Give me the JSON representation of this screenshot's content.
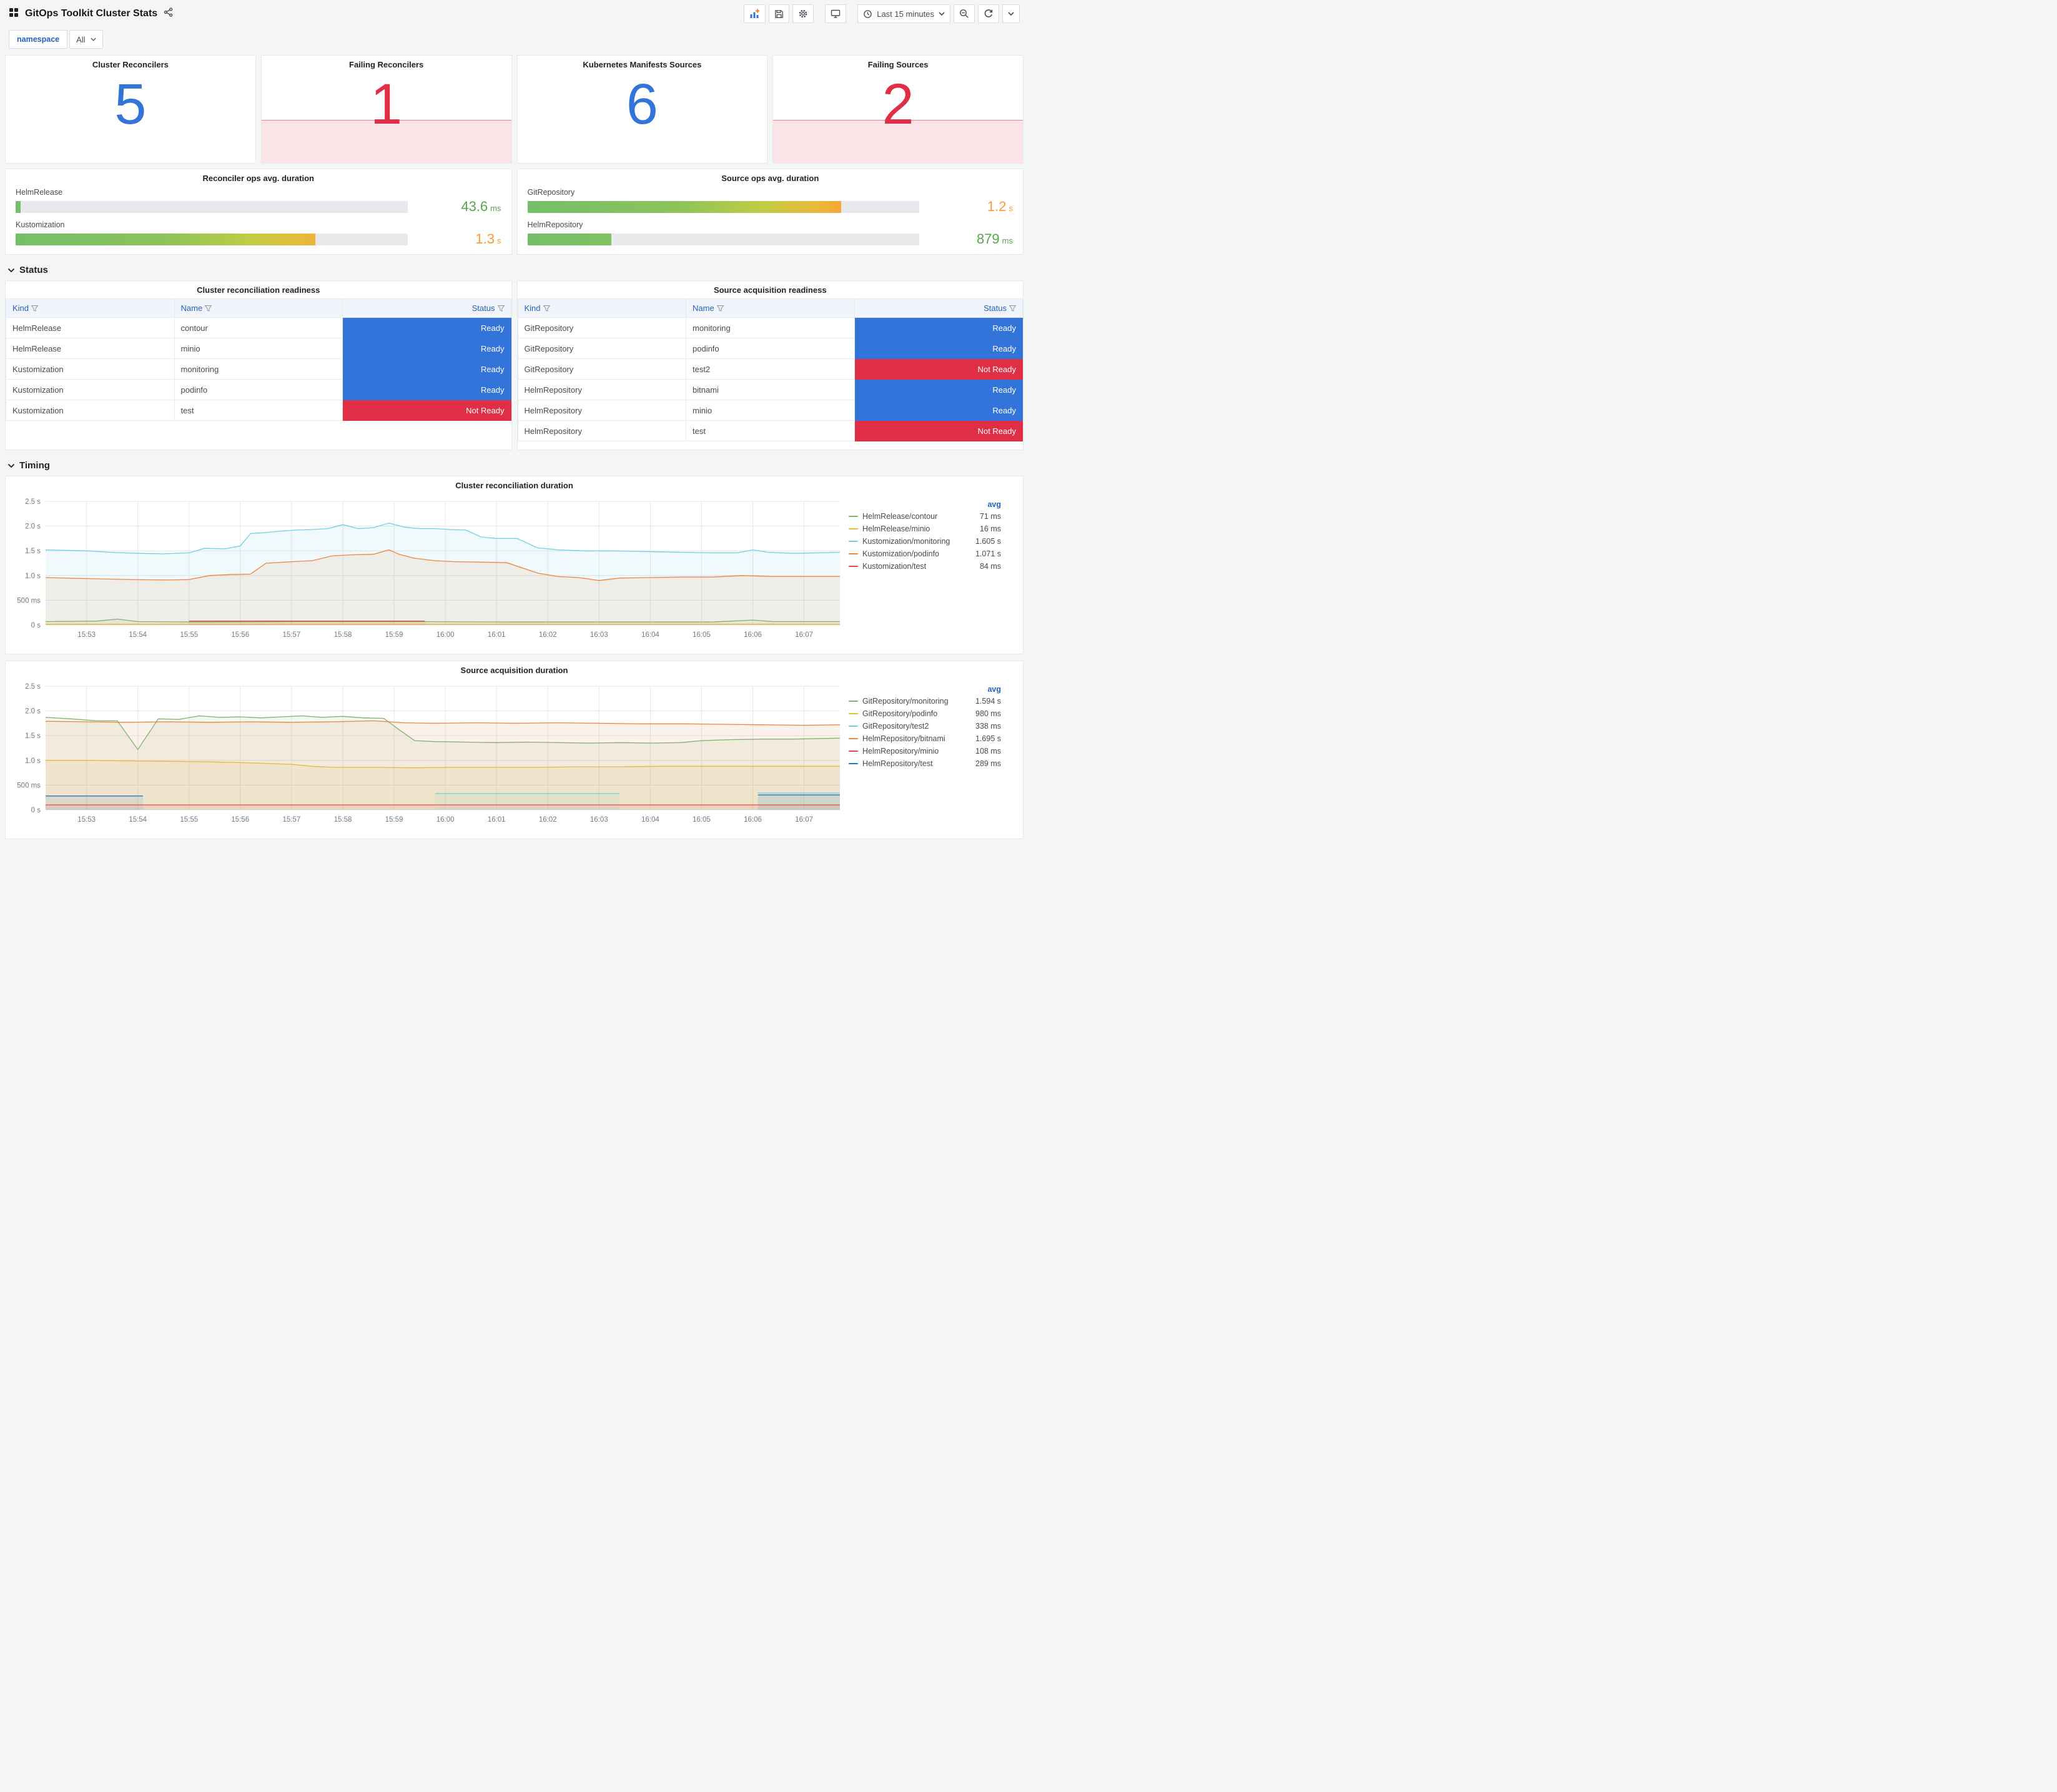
{
  "header": {
    "title": "GitOps Toolkit Cluster Stats",
    "time_range_label": "Last 15 minutes"
  },
  "variables": {
    "label": "namespace",
    "value": "All"
  },
  "icons": [
    "apps-icon",
    "share-icon",
    "add-panel-icon",
    "save-icon",
    "gear-icon",
    "tv-icon",
    "clock-icon",
    "caret-down-icon",
    "zoom-out-icon",
    "refresh-icon",
    "filter-icon",
    "chevron-down-icon"
  ],
  "sections": {
    "status": "Status",
    "timing": "Timing"
  },
  "stats": [
    {
      "title": "Cluster Reconcilers",
      "value": "5",
      "color": "#3274d9",
      "alert_band": false
    },
    {
      "title": "Failing Reconcilers",
      "value": "1",
      "color": "#e02f44",
      "alert_band": true
    },
    {
      "title": "Kubernetes Manifests Sources",
      "value": "6",
      "color": "#3274d9",
      "alert_band": false
    },
    {
      "title": "Failing Sources",
      "value": "2",
      "color": "#e02f44",
      "alert_band": true
    }
  ],
  "gauges": [
    {
      "title": "Reconciler ops avg. duration",
      "bars": [
        {
          "label": "HelmRelease",
          "value": "43.6",
          "unit": "ms",
          "percent": 1.2,
          "value_color": "#56a64b"
        },
        {
          "label": "Kustomization",
          "value": "1.3",
          "unit": "s",
          "percent": 76.5,
          "value_color": "#ff9830"
        }
      ]
    },
    {
      "title": "Source ops avg. duration",
      "bars": [
        {
          "label": "GitRepository",
          "value": "1.2",
          "unit": "s",
          "percent": 80,
          "value_color": "#ff9830"
        },
        {
          "label": "HelmRepository",
          "value": "879",
          "unit": "ms",
          "percent": 21.5,
          "value_color": "#56a64b"
        }
      ]
    }
  ],
  "tables": [
    {
      "title": "Cluster reconciliation readiness",
      "columns": [
        "Kind",
        "Name",
        "Status"
      ],
      "rows": [
        {
          "kind": "HelmRelease",
          "name": "contour",
          "status": "Ready"
        },
        {
          "kind": "HelmRelease",
          "name": "minio",
          "status": "Ready"
        },
        {
          "kind": "Kustomization",
          "name": "monitoring",
          "status": "Ready"
        },
        {
          "kind": "Kustomization",
          "name": "podinfo",
          "status": "Ready"
        },
        {
          "kind": "Kustomization",
          "name": "test",
          "status": "Not Ready"
        }
      ]
    },
    {
      "title": "Source acquisition readiness",
      "columns": [
        "Kind",
        "Name",
        "Status"
      ],
      "rows": [
        {
          "kind": "GitRepository",
          "name": "monitoring",
          "status": "Ready"
        },
        {
          "kind": "GitRepository",
          "name": "podinfo",
          "status": "Ready"
        },
        {
          "kind": "GitRepository",
          "name": "test2",
          "status": "Not Ready"
        },
        {
          "kind": "HelmRepository",
          "name": "bitnami",
          "status": "Ready"
        },
        {
          "kind": "HelmRepository",
          "name": "minio",
          "status": "Ready"
        },
        {
          "kind": "HelmRepository",
          "name": "test",
          "status": "Not Ready"
        }
      ]
    }
  ],
  "chart_data": [
    {
      "type": "line",
      "title": "Cluster reconciliation duration",
      "legend_header": "avg",
      "x_domain": [
        0,
        15.5
      ],
      "y_domain": [
        0,
        2.5
      ],
      "x_tick_start": 0.8,
      "x_tick_step": 1,
      "x_tick_labels": [
        "15:53",
        "15:54",
        "15:55",
        "15:56",
        "15:57",
        "15:58",
        "15:59",
        "16:00",
        "16:01",
        "16:02",
        "16:03",
        "16:04",
        "16:05",
        "16:06",
        "16:07"
      ],
      "y_ticks": [
        {
          "v": 0,
          "label": "0 s"
        },
        {
          "v": 0.5,
          "label": "500 ms"
        },
        {
          "v": 1,
          "label": "1.0 s"
        },
        {
          "v": 1.5,
          "label": "1.5 s"
        },
        {
          "v": 2,
          "label": "2.0 s"
        },
        {
          "v": 2.5,
          "label": "2.5 s"
        }
      ],
      "series": [
        {
          "name": "HelmRelease/contour",
          "color": "#7EB26D",
          "avg": "71 ms",
          "points": [
            [
              0,
              0.07
            ],
            [
              1,
              0.08
            ],
            [
              1.4,
              0.12
            ],
            [
              1.8,
              0.07
            ],
            [
              3,
              0.06
            ],
            [
              5,
              0.07
            ],
            [
              7,
              0.07
            ],
            [
              9,
              0.06
            ],
            [
              11,
              0.06
            ],
            [
              13,
              0.06
            ],
            [
              13.8,
              0.1
            ],
            [
              14.2,
              0.07
            ],
            [
              15.5,
              0.07
            ]
          ]
        },
        {
          "name": "HelmRelease/minio",
          "color": "#EAB839",
          "avg": "16 ms",
          "points": [
            [
              0,
              0.016
            ],
            [
              15.5,
              0.016
            ]
          ]
        },
        {
          "name": "Kustomization/monitoring",
          "color": "#6ED0E0",
          "avg": "1.605 s",
          "points": [
            [
              0,
              1.52
            ],
            [
              0.8,
              1.5
            ],
            [
              1.3,
              1.47
            ],
            [
              1.8,
              1.45
            ],
            [
              2.3,
              1.44
            ],
            [
              2.8,
              1.46
            ],
            [
              3.1,
              1.55
            ],
            [
              3.5,
              1.54
            ],
            [
              3.8,
              1.6
            ],
            [
              4,
              1.85
            ],
            [
              4.3,
              1.87
            ],
            [
              4.6,
              1.9
            ],
            [
              4.9,
              1.92
            ],
            [
              5.2,
              1.93
            ],
            [
              5.5,
              1.95
            ],
            [
              5.8,
              2.03
            ],
            [
              6.1,
              1.95
            ],
            [
              6.4,
              1.97
            ],
            [
              6.7,
              2.06
            ],
            [
              7,
              1.98
            ],
            [
              7.3,
              1.95
            ],
            [
              7.6,
              1.95
            ],
            [
              7.9,
              1.93
            ],
            [
              8.2,
              1.92
            ],
            [
              8.5,
              1.78
            ],
            [
              8.8,
              1.75
            ],
            [
              9.2,
              1.75
            ],
            [
              9.6,
              1.56
            ],
            [
              10,
              1.52
            ],
            [
              10.5,
              1.5
            ],
            [
              11,
              1.5
            ],
            [
              11.5,
              1.49
            ],
            [
              12,
              1.48
            ],
            [
              12.5,
              1.47
            ],
            [
              13,
              1.46
            ],
            [
              13.5,
              1.46
            ],
            [
              13.8,
              1.52
            ],
            [
              14.1,
              1.47
            ],
            [
              14.6,
              1.45
            ],
            [
              15.5,
              1.47
            ]
          ]
        },
        {
          "name": "Kustomization/podinfo",
          "color": "#EF843C",
          "avg": "1.071 s",
          "points": [
            [
              0,
              0.96
            ],
            [
              0.8,
              0.94
            ],
            [
              1.6,
              0.92
            ],
            [
              2.4,
              0.91
            ],
            [
              2.8,
              0.92
            ],
            [
              3.2,
              1
            ],
            [
              3.6,
              1.02
            ],
            [
              4,
              1.03
            ],
            [
              4.3,
              1.25
            ],
            [
              4.8,
              1.28
            ],
            [
              5.2,
              1.3
            ],
            [
              5.6,
              1.4
            ],
            [
              6,
              1.42
            ],
            [
              6.4,
              1.43
            ],
            [
              6.7,
              1.52
            ],
            [
              6.9,
              1.43
            ],
            [
              7.2,
              1.35
            ],
            [
              7.6,
              1.3
            ],
            [
              8,
              1.28
            ],
            [
              8.6,
              1.27
            ],
            [
              9,
              1.26
            ],
            [
              9.6,
              1.05
            ],
            [
              10,
              0.98
            ],
            [
              10.4,
              0.96
            ],
            [
              10.8,
              0.9
            ],
            [
              11.2,
              0.95
            ],
            [
              11.8,
              0.96
            ],
            [
              12.4,
              0.97
            ],
            [
              13,
              0.97
            ],
            [
              13.6,
              1
            ],
            [
              14.2,
              0.98
            ],
            [
              15.5,
              0.98
            ]
          ]
        },
        {
          "name": "Kustomization/test",
          "color": "#E24D42",
          "avg": "84 ms",
          "points": [
            [
              2.8,
              0.08
            ],
            [
              7.4,
              0.08
            ]
          ]
        }
      ]
    },
    {
      "type": "line",
      "title": "Source acquisition duration",
      "legend_header": "avg",
      "x_domain": [
        0,
        15.5
      ],
      "y_domain": [
        0,
        2.5
      ],
      "x_tick_start": 0.8,
      "x_tick_step": 1,
      "x_tick_labels": [
        "15:53",
        "15:54",
        "15:55",
        "15:56",
        "15:57",
        "15:58",
        "15:59",
        "16:00",
        "16:01",
        "16:02",
        "16:03",
        "16:04",
        "16:05",
        "16:06",
        "16:07"
      ],
      "y_ticks": [
        {
          "v": 0,
          "label": "0 s"
        },
        {
          "v": 0.5,
          "label": "500 ms"
        },
        {
          "v": 1,
          "label": "1.0 s"
        },
        {
          "v": 1.5,
          "label": "1.5 s"
        },
        {
          "v": 2,
          "label": "2.0 s"
        },
        {
          "v": 2.5,
          "label": "2.5 s"
        }
      ],
      "series": [
        {
          "name": "GitRepository/monitoring",
          "color": "#7EB26D",
          "avg": "1.594 s",
          "points": [
            [
              0,
              1.87
            ],
            [
              0.5,
              1.84
            ],
            [
              1,
              1.8
            ],
            [
              1.4,
              1.8
            ],
            [
              1.8,
              1.22
            ],
            [
              2.2,
              1.84
            ],
            [
              2.6,
              1.83
            ],
            [
              3,
              1.9
            ],
            [
              3.4,
              1.87
            ],
            [
              3.8,
              1.88
            ],
            [
              4.2,
              1.86
            ],
            [
              4.6,
              1.88
            ],
            [
              5,
              1.9
            ],
            [
              5.4,
              1.87
            ],
            [
              5.8,
              1.89
            ],
            [
              6.2,
              1.86
            ],
            [
              6.6,
              1.85
            ],
            [
              6.9,
              1.62
            ],
            [
              7.2,
              1.4
            ],
            [
              7.6,
              1.38
            ],
            [
              8.2,
              1.37
            ],
            [
              8.8,
              1.36
            ],
            [
              9.4,
              1.37
            ],
            [
              10,
              1.36
            ],
            [
              10.6,
              1.35
            ],
            [
              11.2,
              1.36
            ],
            [
              11.8,
              1.35
            ],
            [
              12.4,
              1.36
            ],
            [
              12.8,
              1.4
            ],
            [
              13.4,
              1.42
            ],
            [
              14,
              1.43
            ],
            [
              14.6,
              1.43
            ],
            [
              15.5,
              1.45
            ]
          ]
        },
        {
          "name": "GitRepository/podinfo",
          "color": "#EAB839",
          "avg": "980 ms",
          "points": [
            [
              0,
              1
            ],
            [
              0.8,
              1
            ],
            [
              1.6,
              0.99
            ],
            [
              2.4,
              0.98
            ],
            [
              3.2,
              0.97
            ],
            [
              4,
              0.95
            ],
            [
              4.8,
              0.92
            ],
            [
              5.2,
              0.88
            ],
            [
              5.6,
              0.86
            ],
            [
              6.4,
              0.86
            ],
            [
              7.2,
              0.85
            ],
            [
              8,
              0.86
            ],
            [
              8.8,
              0.86
            ],
            [
              9.6,
              0.86
            ],
            [
              10.4,
              0.87
            ],
            [
              11.2,
              0.87
            ],
            [
              12,
              0.88
            ],
            [
              12.8,
              0.88
            ],
            [
              13.6,
              0.88
            ],
            [
              14.4,
              0.88
            ],
            [
              15.5,
              0.88
            ]
          ]
        },
        {
          "name": "GitRepository/test2",
          "color": "#6ED0E0",
          "avg": "338 ms",
          "points": [
            [
              7.6,
              0.33
            ],
            [
              11.2,
              0.33
            ],
            [
              11.3,
              null
            ],
            [
              13.9,
              0.34
            ],
            [
              15.5,
              0.34
            ]
          ]
        },
        {
          "name": "HelmRepository/bitnami",
          "color": "#EF843C",
          "avg": "1.695 s",
          "points": [
            [
              0,
              1.79
            ],
            [
              0.8,
              1.78
            ],
            [
              1.6,
              1.77
            ],
            [
              2.4,
              1.78
            ],
            [
              3.2,
              1.77
            ],
            [
              4,
              1.78
            ],
            [
              4.8,
              1.77
            ],
            [
              5.6,
              1.78
            ],
            [
              6.4,
              1.8
            ],
            [
              7,
              1.76
            ],
            [
              7.6,
              1.75
            ],
            [
              8.4,
              1.76
            ],
            [
              9.2,
              1.75
            ],
            [
              10,
              1.76
            ],
            [
              10.8,
              1.75
            ],
            [
              11.6,
              1.74
            ],
            [
              12.4,
              1.74
            ],
            [
              13.2,
              1.73
            ],
            [
              14,
              1.72
            ],
            [
              14.8,
              1.71
            ],
            [
              15.5,
              1.72
            ]
          ]
        },
        {
          "name": "HelmRepository/minio",
          "color": "#E24D42",
          "avg": "108 ms",
          "points": [
            [
              0,
              0.1
            ],
            [
              15.5,
              0.1
            ]
          ]
        },
        {
          "name": "HelmRepository/test",
          "color": "#1F78C1",
          "avg": "289 ms",
          "points": [
            [
              0,
              0.28
            ],
            [
              1.9,
              0.28
            ],
            [
              2,
              null
            ],
            [
              13.9,
              0.3
            ],
            [
              15.5,
              0.3
            ]
          ]
        }
      ]
    }
  ]
}
